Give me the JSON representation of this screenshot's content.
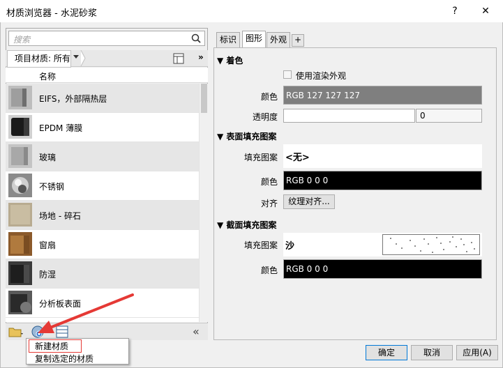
{
  "window": {
    "title": "材质浏览器 - 水泥砂浆",
    "help_label": "?",
    "close_label": "✕"
  },
  "search": {
    "placeholder": "搜索"
  },
  "filter": {
    "label": "项目材质: 所有",
    "more_label": "»"
  },
  "list": {
    "header": "名称",
    "items": [
      {
        "name": "EIFS，外部隔热层",
        "icon": "eifs-swatch"
      },
      {
        "name": "EPDM 薄膜",
        "icon": "epdm-swatch"
      },
      {
        "name": "玻璃",
        "icon": "glass-swatch"
      },
      {
        "name": "不锈钢",
        "icon": "steel-swatch"
      },
      {
        "name": "场地 - 碎石",
        "icon": "gravel-swatch"
      },
      {
        "name": "窗扇",
        "icon": "wood-swatch"
      },
      {
        "name": "防湿",
        "icon": "damp-swatch"
      },
      {
        "name": "分析板表面",
        "icon": "panel-swatch"
      }
    ]
  },
  "bottom": {
    "collapse_label": "«"
  },
  "context_menu": {
    "items": [
      "新建材质",
      "复制选定的材质"
    ]
  },
  "tabs": [
    "标识",
    "图形",
    "外观"
  ],
  "tab_add_label": "+",
  "shading": {
    "heading": "着色",
    "use_render_label": "使用渲染外观",
    "color_label": "颜色",
    "color_value": "RGB 127 127 127",
    "color_hex": "#7f7f7f",
    "transparency_label": "透明度",
    "transparency_value": "0"
  },
  "surface": {
    "heading": "表面填充图案",
    "pattern_label": "填充图案",
    "pattern_value": "<无>",
    "color_label": "颜色",
    "color_value": "RGB 0 0 0",
    "align_label": "对齐",
    "align_button": "纹理对齐..."
  },
  "cut": {
    "heading": "截面填充图案",
    "pattern_label": "填充图案",
    "pattern_value": "沙",
    "color_label": "颜色",
    "color_value": "RGB 0 0 0"
  },
  "buttons": {
    "ok": "确定",
    "cancel": "取消",
    "apply": "应用(A)"
  },
  "colors": {
    "accent": "#0078d7",
    "highlight_box": "#e53935",
    "arrow": "#e53935"
  }
}
